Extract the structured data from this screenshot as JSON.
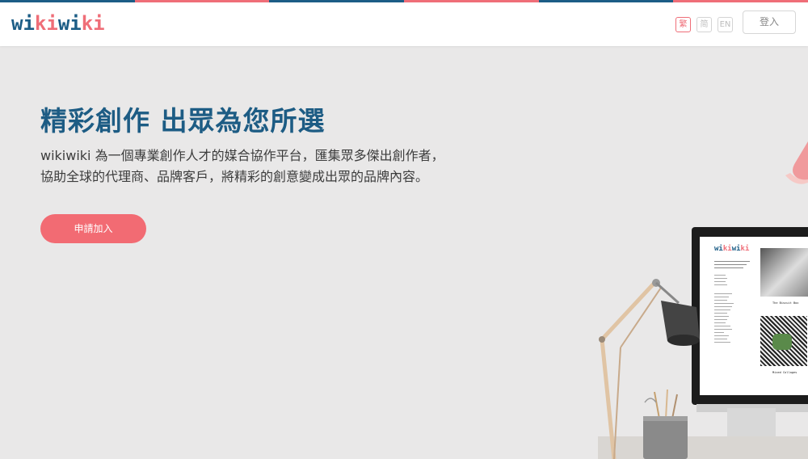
{
  "header": {
    "logo": {
      "part1": "wi",
      "part2": "ki",
      "part3": "wi",
      "part4": "ki"
    },
    "languages": [
      {
        "label": "繁",
        "active": true
      },
      {
        "label": "简",
        "active": false
      },
      {
        "label": "EN",
        "active": false
      }
    ],
    "login_label": "登入"
  },
  "hero": {
    "title": "精彩創作 出眾為您所選",
    "description": "wikiwiki 為一個專業創作人才的媒合協作平台，匯集眾多傑出創作者，協助全球的代理商、品牌客戶，將精彩的創意變成出眾的品牌內容。",
    "cta_label": "申請加入"
  },
  "monitor": {
    "logo": {
      "part1": "wi",
      "part2": "ki",
      "part3": "wi",
      "part4": "ki"
    },
    "thumb1_label": "The Biscuit Box",
    "thumb2_label": "Mixed Collages"
  },
  "colors": {
    "brand_blue": "#1c5d86",
    "brand_pink": "#ef6e78",
    "cta": "#f26b73",
    "strip": [
      "#1c5d86",
      "#ef6e78",
      "#1c5d86",
      "#ef6e78",
      "#1c5d86",
      "#ef6e78"
    ]
  }
}
